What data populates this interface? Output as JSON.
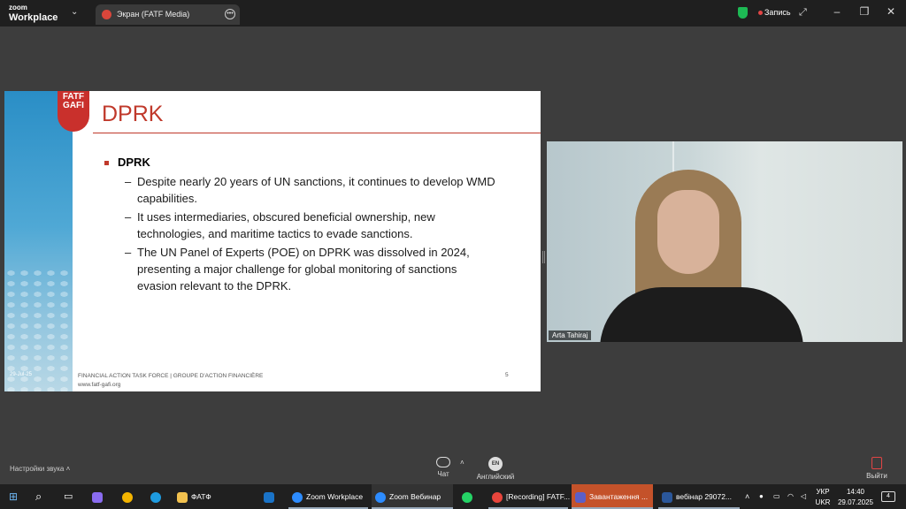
{
  "titlebar": {
    "logo_small": "zoom",
    "logo_big": "Workplace",
    "tab_label": "Экран (FATF Media)",
    "record_label": "Запись"
  },
  "slide": {
    "badge_top": "FATF",
    "badge_bottom": "GAFI",
    "title": "DPRK",
    "bullet": "DPRK",
    "sub_bullets": [
      "Despite nearly 20 years of UN sanctions, it continues to develop WMD capabilities.",
      "It uses intermediaries, obscured beneficial ownership, new technologies, and maritime tactics to evade sanctions.",
      "The UN Panel of Experts (POE) on DPRK was dissolved in 2024, presenting a major challenge for global monitoring of sanctions evasion relevant to the DPRK."
    ],
    "date": "29-Jul-25",
    "footer_line1": "FINANCIAL ACTION TASK FORCE | GROUPE D'ACTION FINANCIÈRE",
    "footer_line2": "www.fatf-gafi.org",
    "page_number": "5"
  },
  "video": {
    "participant_name": "Arta Tahiraj"
  },
  "toolbar": {
    "sound_settings": "Настройки звука",
    "chat_label": "Чат",
    "language_code": "EN",
    "language_label": "Английский",
    "exit_label": "Выйти"
  },
  "taskbar": {
    "items": [
      "ФАТФ",
      "Zoom Workplace",
      "Zoom Вебинар",
      "[Recording] FATF...",
      "Завантаження ...",
      "вебінар 29072..."
    ],
    "lang_top": "УКР",
    "lang_bottom": "UKR",
    "time": "14:40",
    "date": "29.07.2025",
    "notification_count": "4"
  },
  "colors": {
    "accent_red": "#c0392b",
    "record_red": "#e24545",
    "shield_green": "#1db954"
  }
}
